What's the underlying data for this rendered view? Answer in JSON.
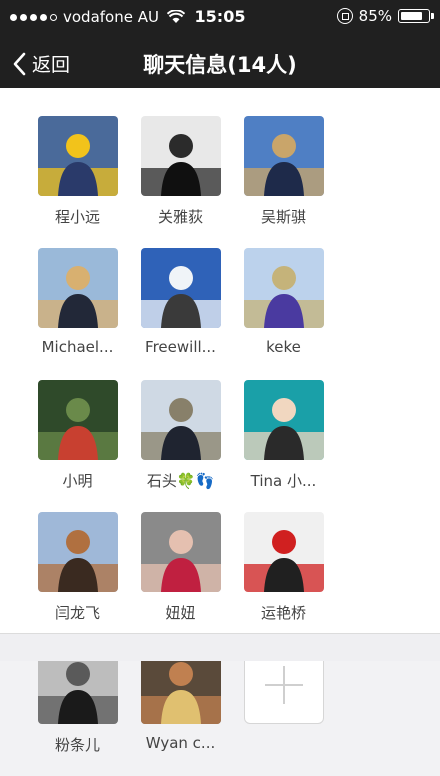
{
  "status": {
    "carrier": "vodafone AU",
    "time": "15:05",
    "battery": "85%",
    "battery_level": 0.85
  },
  "nav": {
    "back_label": "返回",
    "title": "聊天信息(14人)"
  },
  "members": [
    {
      "name": "程小远",
      "colors": [
        "#4a6a9a",
        "#f2c31b",
        "#2a3a6a"
      ]
    },
    {
      "name": "关雅荻",
      "colors": [
        "#e8e8e8",
        "#2b2b2b",
        "#101010"
      ]
    },
    {
      "name": "吴斯骐",
      "colors": [
        "#4f7fc4",
        "#c9a56a",
        "#1e2a4a"
      ]
    },
    {
      "name": "Michael...",
      "colors": [
        "#9ab9d9",
        "#d8b070",
        "#222838"
      ]
    },
    {
      "name": "Freewill...",
      "colors": [
        "#2f62b8",
        "#f0f4f8",
        "#3a3a3a"
      ]
    },
    {
      "name": "keke",
      "colors": [
        "#bcd2ec",
        "#c5b37a",
        "#4a3aa0"
      ]
    },
    {
      "name": "小明",
      "colors": [
        "#2f4a2a",
        "#6a8a4a",
        "#c84030"
      ]
    },
    {
      "name": "石头🍀👣",
      "colors": [
        "#cfd9e4",
        "#88806a",
        "#1f2430"
      ]
    },
    {
      "name": "Tina 小...",
      "colors": [
        "#1aa0a8",
        "#f1d7c0",
        "#2a2a2a"
      ]
    },
    {
      "name": "闫龙飞",
      "colors": [
        "#9fb8d8",
        "#b07040",
        "#3a2a20"
      ]
    },
    {
      "name": "妞妞",
      "colors": [
        "#8a8a8a",
        "#e5c0b0",
        "#c02040"
      ]
    },
    {
      "name": "运艳桥",
      "colors": [
        "#f0f0f0",
        "#d02020",
        "#202020"
      ]
    },
    {
      "name": "粉条儿",
      "colors": [
        "#bdbdbd",
        "#5a5a5a",
        "#1a1a1a"
      ]
    },
    {
      "name": "Wyan c...",
      "colors": [
        "#5a4a3a",
        "#c08050",
        "#e0c070"
      ]
    }
  ],
  "add_member": {
    "icon": "plus-icon"
  }
}
